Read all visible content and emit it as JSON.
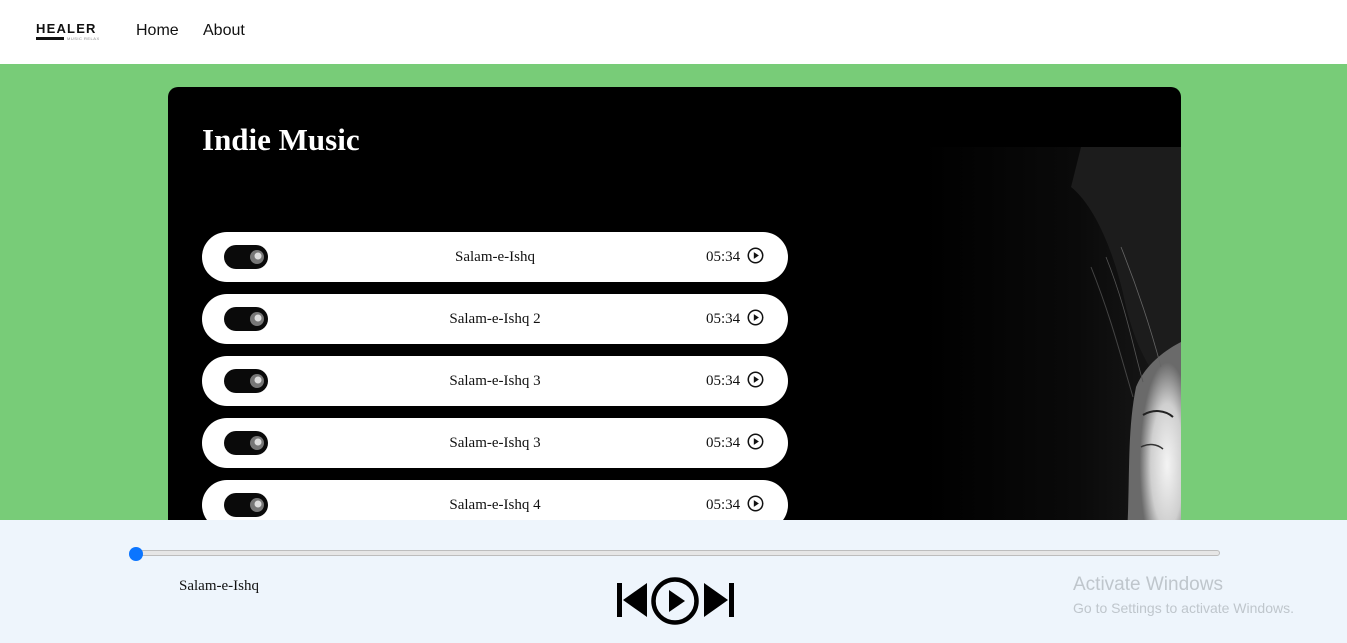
{
  "nav": {
    "logo_text": "HEALER",
    "logo_subtext": "MUSIC RELAX",
    "links": [
      "Home",
      "About"
    ]
  },
  "main": {
    "title": "Indie Music",
    "tracks": [
      {
        "title": "Salam-e-Ishq",
        "duration": "05:34"
      },
      {
        "title": "Salam-e-Ishq 2",
        "duration": "05:34"
      },
      {
        "title": "Salam-e-Ishq 3",
        "duration": "05:34"
      },
      {
        "title": "Salam-e-Ishq 3",
        "duration": "05:34"
      },
      {
        "title": "Salam-e-Ishq 4",
        "duration": "05:34"
      }
    ]
  },
  "player": {
    "now_playing": "Salam-e-Ishq",
    "progress": 0
  },
  "overlay": {
    "activate_title": "Activate Windows",
    "activate_sub": "Go to Settings to activate Windows."
  },
  "colors": {
    "page_background": "#78cc78",
    "card_background": "#000000",
    "player_background": "#eef5fc",
    "progress_accent": "#0b75ff"
  },
  "icons": [
    "play-circle-icon",
    "previous-icon",
    "play-icon",
    "next-icon"
  ]
}
